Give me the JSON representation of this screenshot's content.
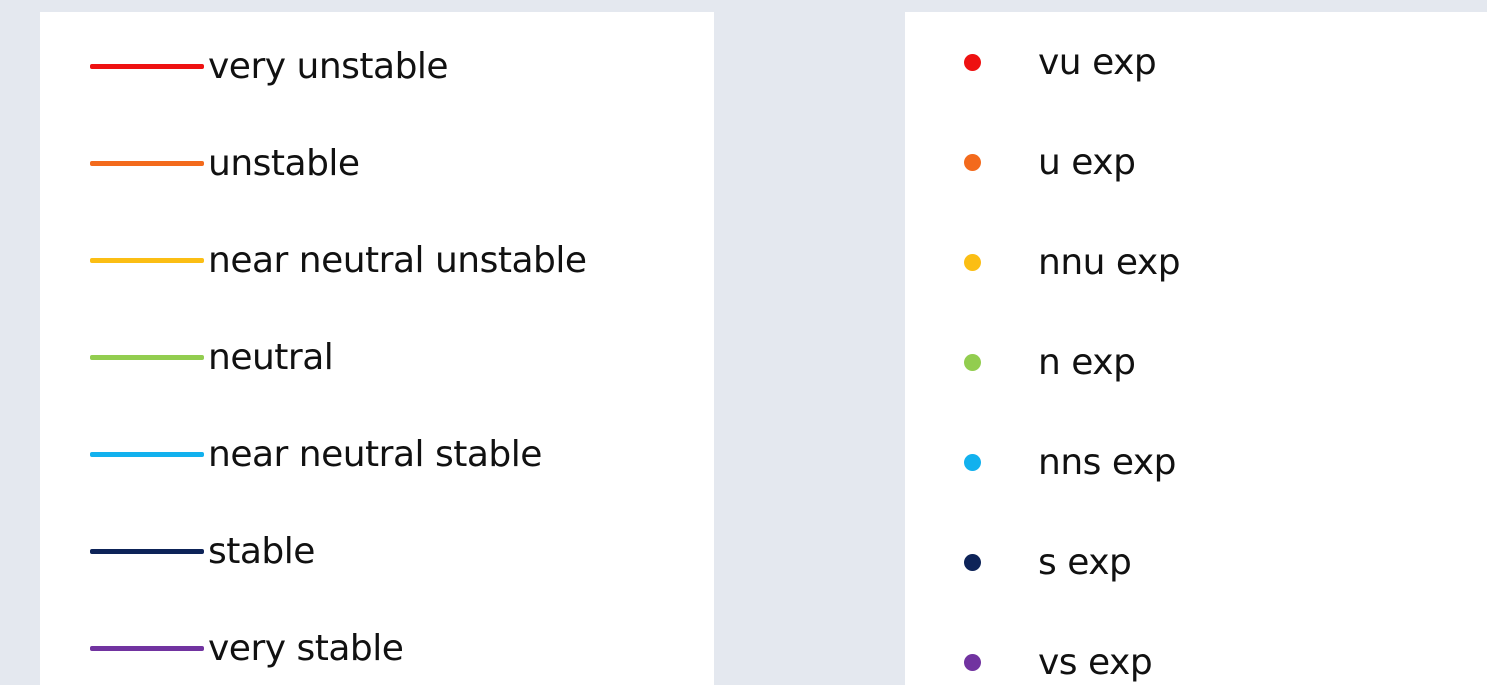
{
  "chart_data": {
    "type": "legend",
    "legends": [
      {
        "kind": "line",
        "entries": [
          {
            "label": "very unstable",
            "color": "#ee1111"
          },
          {
            "label": "unstable",
            "color": "#f36a1c"
          },
          {
            "label": "near neutral unstable",
            "color": "#fbbe14"
          },
          {
            "label": "neutral",
            "color": "#92cd4f"
          },
          {
            "label": "near neutral stable",
            "color": "#12b1ee"
          },
          {
            "label": "stable",
            "color": "#0d2358"
          },
          {
            "label": "very stable",
            "color": "#7133a0"
          }
        ]
      },
      {
        "kind": "marker",
        "entries": [
          {
            "label": "vu exp",
            "color": "#ee1111"
          },
          {
            "label": "u exp",
            "color": "#f36a1c"
          },
          {
            "label": "nnu exp",
            "color": "#fbbe14"
          },
          {
            "label": "n exp",
            "color": "#92cd4f"
          },
          {
            "label": "nns exp",
            "color": "#12b1ee"
          },
          {
            "label": "s exp",
            "color": "#0d2358"
          },
          {
            "label": "vs exp",
            "color": "#7133a0"
          }
        ]
      }
    ]
  }
}
